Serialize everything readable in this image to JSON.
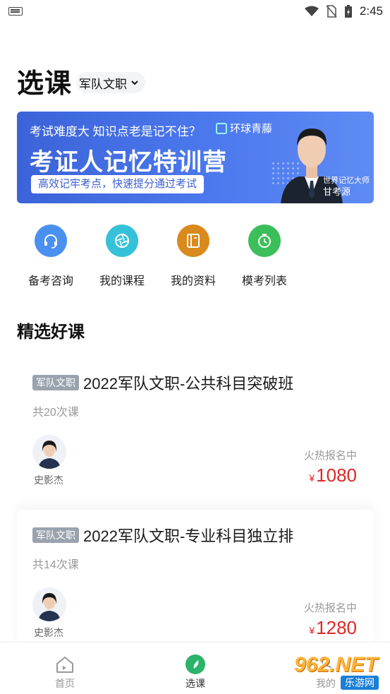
{
  "status_bar": {
    "time": "2:45"
  },
  "header": {
    "title": "选课",
    "category": "军队文职"
  },
  "banner": {
    "line1": "考试难度大 知识点老是记不住？",
    "brand": "环球青藤",
    "main": "考证人记忆特训营",
    "pill": "高效记牢考点，快速提分通过考试",
    "caption_title": "世界记忆大师",
    "caption_name": "甘考源"
  },
  "quick_links": [
    {
      "label": "备考咨询",
      "icon": "headset-icon",
      "color": "#4a90f0"
    },
    {
      "label": "我的课程",
      "icon": "aperture-icon",
      "color": "#35c1d8"
    },
    {
      "label": "我的资料",
      "icon": "book-icon",
      "color": "#d98a1c"
    },
    {
      "label": "模考列表",
      "icon": "stopwatch-icon",
      "color": "#3cbf5a"
    }
  ],
  "section_title": "精选好课",
  "courses": [
    {
      "tag": "军队文职",
      "name": "2022军队文职-公共科目突破班",
      "count": "共20次课",
      "teacher": "史影杰",
      "status": "火热报名中",
      "currency": "¥",
      "price": "1080"
    },
    {
      "tag": "军队文职",
      "name": "2022军队文职-专业科目独立排",
      "count": "共14次课",
      "teacher": "史影杰",
      "status": "火热报名中",
      "currency": "¥",
      "price": "1280"
    }
  ],
  "tabs": [
    {
      "label": "首页",
      "icon": "home-icon"
    },
    {
      "label": "选课",
      "icon": "compass-icon",
      "active": true
    },
    {
      "label": "我的",
      "icon": "person-icon"
    }
  ],
  "watermark": {
    "big": "962.NET",
    "sub": "乐游网"
  },
  "colors": {
    "accent_green": "#2cb36b",
    "price_red": "#e02727",
    "banner_blue": "#4c79ee"
  }
}
